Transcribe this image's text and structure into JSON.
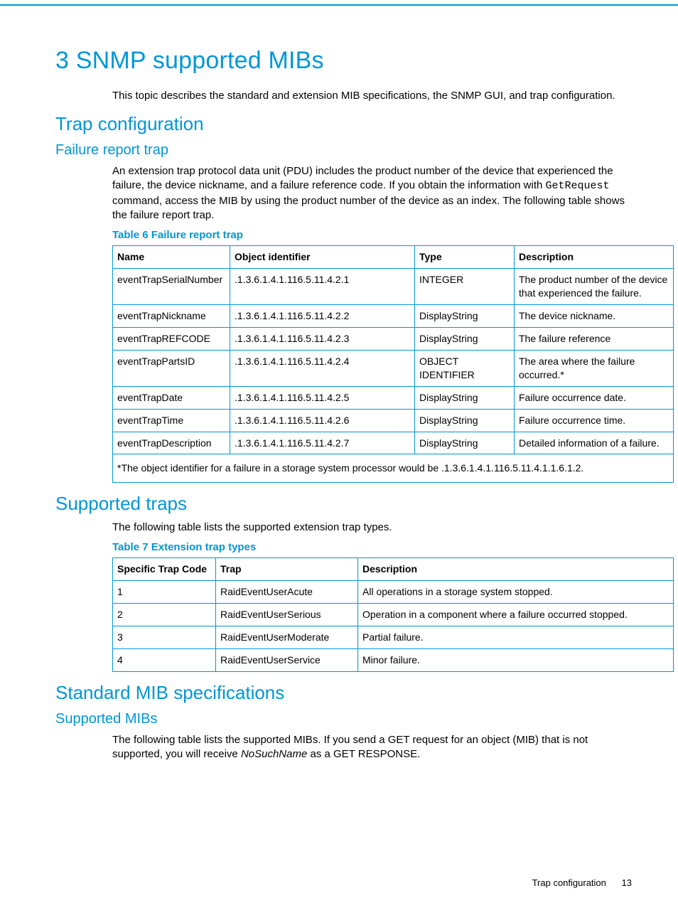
{
  "chapter_title": "3 SNMP supported MIBs",
  "intro": "This topic describes the standard and extension MIB specifications, the SNMP GUI, and trap configuration.",
  "trap_config_heading": "Trap configuration",
  "failure_trap_heading": "Failure report trap",
  "failure_trap_body_pre": "An extension trap protocol data unit (PDU) includes the product number of the device that experienced the failure, the device nickname, and a failure reference code. If you obtain the information with ",
  "failure_trap_code": "GetRequest",
  "failure_trap_body_post": " command, access the MIB by using the product number of the device as an index. The following table shows the failure report trap.",
  "table6_caption": "Table 6 Failure report trap",
  "table6_headers": {
    "c0": "Name",
    "c1": "Object identifier",
    "c2": "Type",
    "c3": "Description"
  },
  "table6_rows": [
    {
      "name": "eventTrapSerialNumber",
      "oid": ".1.3.6.1.4.1.116.5.11.4.2.1",
      "type": "INTEGER",
      "desc": "The product number of the device that experienced the failure."
    },
    {
      "name": "eventTrapNickname",
      "oid": ".1.3.6.1.4.1.116.5.11.4.2.2",
      "type": "DisplayString",
      "desc": "The device nickname."
    },
    {
      "name": "eventTrapREFCODE",
      "oid": ".1.3.6.1.4.1.116.5.11.4.2.3",
      "type": "DisplayString",
      "desc": "The failure reference"
    },
    {
      "name": "eventTrapPartsID",
      "oid": ".1.3.6.1.4.1.116.5.11.4.2.4",
      "type": "OBJECT IDENTIFIER",
      "desc": "The area where the failure occurred.*"
    },
    {
      "name": "eventTrapDate",
      "oid": ".1.3.6.1.4.1.116.5.11.4.2.5",
      "type": "DisplayString",
      "desc": "Failure occurrence date."
    },
    {
      "name": "eventTrapTime",
      "oid": ".1.3.6.1.4.1.116.5.11.4.2.6",
      "type": "DisplayString",
      "desc": "Failure occurrence time."
    },
    {
      "name": "eventTrapDescription",
      "oid": ".1.3.6.1.4.1.116.5.11.4.2.7",
      "type": "DisplayString",
      "desc": "Detailed information of a failure."
    }
  ],
  "table6_footnote": "*The object identifier for a failure in a storage system processor would be .1.3.6.1.4.1.116.5.11.4.1.1.6.1.2.",
  "supported_traps_heading": "Supported traps",
  "supported_traps_body": "The following table lists the supported extension trap types.",
  "table7_caption": "Table 7 Extension trap types",
  "table7_headers": {
    "c0": "Specific Trap Code",
    "c1": "Trap",
    "c2": "Description"
  },
  "table7_rows": [
    {
      "code": "1",
      "trap": "RaidEventUserAcute",
      "desc": "All operations in a storage system stopped."
    },
    {
      "code": "2",
      "trap": "RaidEventUserSerious",
      "desc": "Operation in a component where a failure occurred stopped."
    },
    {
      "code": "3",
      "trap": "RaidEventUserModerate",
      "desc": "Partial failure."
    },
    {
      "code": "4",
      "trap": "RaidEventUserService",
      "desc": "Minor failure."
    }
  ],
  "standard_mib_heading": "Standard MIB specifications",
  "supported_mibs_heading": "Supported MIBs",
  "supported_mibs_body_pre": "The following table lists the supported MIBs. If you send a GET request for an object (MIB) that is not supported, you will receive ",
  "supported_mibs_ital": "NoSuchName",
  "supported_mibs_body_post": " as a GET RESPONSE.",
  "footer_label": "Trap configuration",
  "page_number": "13"
}
